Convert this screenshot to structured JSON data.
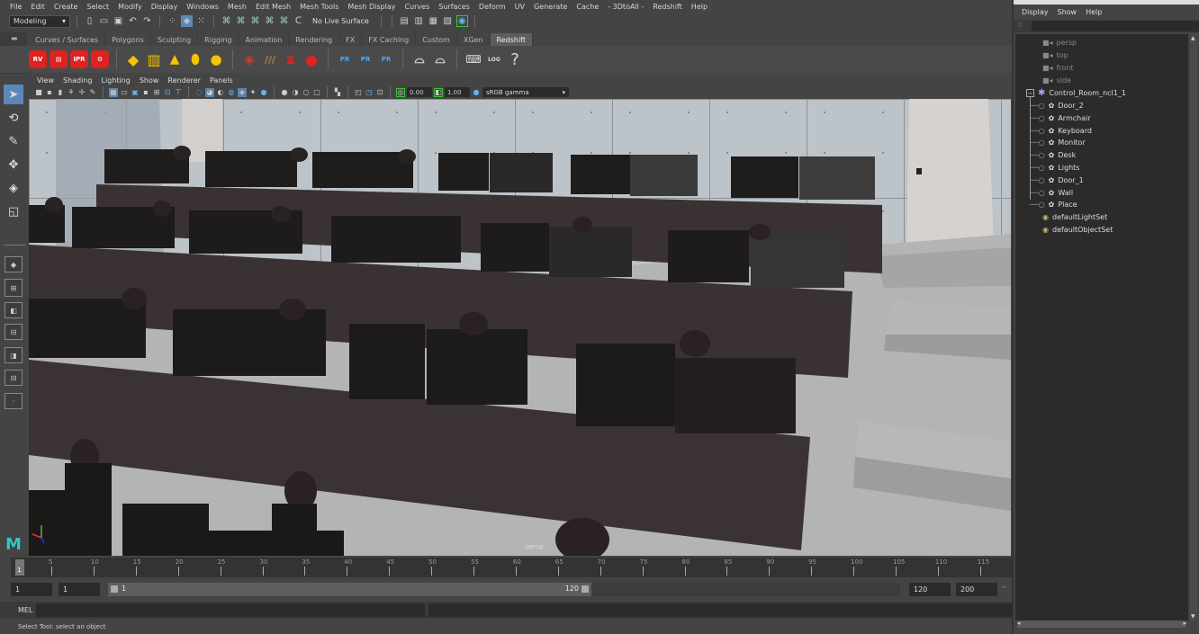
{
  "menubar": {
    "items": [
      "File",
      "Edit",
      "Create",
      "Select",
      "Modify",
      "Display",
      "Windows",
      "Mesh",
      "Edit Mesh",
      "Mesh Tools",
      "Mesh Display",
      "Curves",
      "Surfaces",
      "Deform",
      "UV",
      "Generate",
      "Cache",
      "- 3DtoAll -",
      "Redshift",
      "Help"
    ]
  },
  "statusline": {
    "workspace": "Modeling",
    "live_surface": "No Live Surface"
  },
  "shelf": {
    "tabs": [
      "Curves / Surfaces",
      "Polygons",
      "Sculpting",
      "Rigging",
      "Animation",
      "Rendering",
      "FX",
      "FX Caching",
      "Custom",
      "XGen",
      "Redshift"
    ],
    "active_tab": "Redshift",
    "icon_labels": {
      "rv": "RV",
      "ipr": "IPR",
      "pr": "PR",
      "log": "LOG",
      "help": "?"
    }
  },
  "panel": {
    "menus": [
      "View",
      "Shading",
      "Lighting",
      "Show",
      "Renderer",
      "Panels"
    ],
    "exposure": "0.00",
    "gamma": "1.00",
    "color_space": "sRGB gamma",
    "camera_label": "persp"
  },
  "outliner": {
    "menus": [
      "Display",
      "Show",
      "Help"
    ],
    "cameras": [
      "persp",
      "top",
      "front",
      "side"
    ],
    "group": "Control_Room_ncl1_1",
    "children": [
      "Door_2",
      "Armchair",
      "Keyboard",
      "Monitor",
      "Desk",
      "Lights",
      "Door_1",
      "Wall",
      "Place"
    ],
    "sets": [
      "defaultLightSet",
      "defaultObjectSet"
    ]
  },
  "timeline": {
    "current_frame": "1",
    "ticks": [
      "5",
      "10",
      "15",
      "20",
      "25",
      "30",
      "35",
      "40",
      "45",
      "50",
      "55",
      "60",
      "65",
      "70",
      "75",
      "80",
      "85",
      "90",
      "95",
      "100",
      "105",
      "110",
      "115"
    ]
  },
  "range": {
    "start": "1",
    "playback_start": "1",
    "slider_start": "1",
    "slider_end": "120",
    "playback_end": "120",
    "end": "200"
  },
  "command": {
    "language": "MEL"
  },
  "help_line": "Select Tool: select an object",
  "colors": {
    "accent": "#5b87b8",
    "redshift_red": "#d22222",
    "panel_bg": "#444444",
    "field_bg": "#2b2b2b"
  }
}
